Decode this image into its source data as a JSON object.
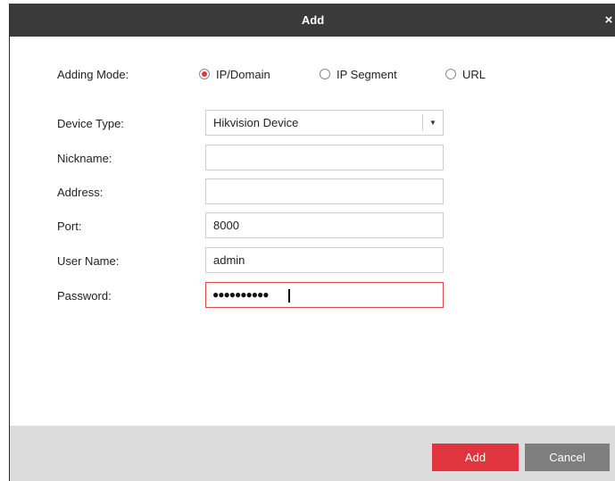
{
  "dialog": {
    "title": "Add",
    "close_glyph": "×",
    "close_icon": "close-icon"
  },
  "adding_mode": {
    "label": "Adding Mode:",
    "options": [
      {
        "label": "IP/Domain",
        "selected": true
      },
      {
        "label": "IP Segment",
        "selected": false
      },
      {
        "label": "URL",
        "selected": false
      }
    ]
  },
  "form": {
    "device_type": {
      "label": "Device Type:",
      "value": "Hikvision Device",
      "arrow_glyph": "▼"
    },
    "nickname": {
      "label": "Nickname:",
      "value": ""
    },
    "address": {
      "label": "Address:",
      "value": ""
    },
    "port": {
      "label": "Port:",
      "value": "8000"
    },
    "user_name": {
      "label": "User Name:",
      "value": "admin"
    },
    "password": {
      "label": "Password:",
      "masked_value": "●●●●●●●●●●"
    }
  },
  "buttons": {
    "add": "Add",
    "cancel": "Cancel"
  },
  "colors": {
    "titlebar": "#3a3a3a",
    "accent": "#e0343e",
    "cancel": "#7e7e7e",
    "footer": "#dcdcdc"
  }
}
